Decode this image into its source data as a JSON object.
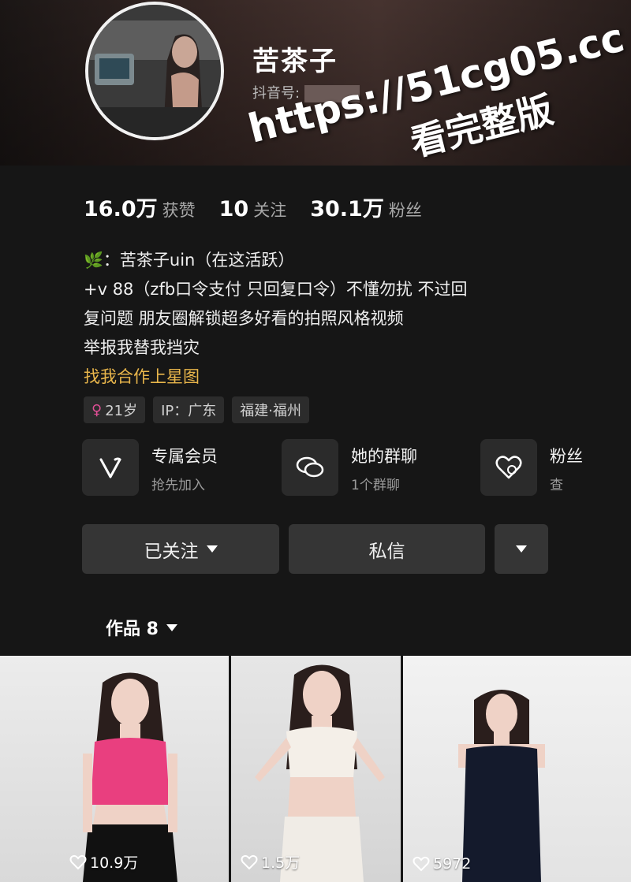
{
  "profile": {
    "nickname": "苦茶子",
    "douyin_id_label": "抖音号:",
    "watermark_url": "https://51cg05.cc",
    "watermark_sub": "看完整版"
  },
  "stats": [
    {
      "value": "16.0万",
      "label": "获赞"
    },
    {
      "value": "10",
      "label": "关注"
    },
    {
      "value": "30.1万",
      "label": "粉丝"
    }
  ],
  "bio": {
    "leaf_emoji": "🌿",
    "line1": "：苦茶子uin（在这活跃）",
    "line2": "+v 88（zfb口令支付 只回复口令）不懂勿扰 不过回",
    "line3": "复问题 朋友圈解锁超多好看的拍照风格视频",
    "line4": "举报我替我挡灾",
    "link": "找我合作上星图"
  },
  "tags": {
    "age": "21岁",
    "ip": "IP：广东",
    "location": "福建·福州"
  },
  "features": [
    {
      "title": "专属会员",
      "subtitle": "抢先加入",
      "icon": "v-icon"
    },
    {
      "title": "她的群聊",
      "subtitle": "1个群聊",
      "icon": "chat-bubbles-icon"
    },
    {
      "title": "粉丝",
      "subtitle": "查",
      "icon": "heart-icon"
    }
  ],
  "actions": {
    "follow_label": "已关注",
    "message_label": "私信"
  },
  "works_tab": {
    "label": "作品 8"
  },
  "videos": [
    {
      "likes": "10.9万"
    },
    {
      "likes": "1.5万"
    },
    {
      "likes": "5972"
    }
  ],
  "colors": {
    "background": "#161616",
    "button": "#353535",
    "link": "#e9b64b",
    "female": "#e04f96"
  }
}
